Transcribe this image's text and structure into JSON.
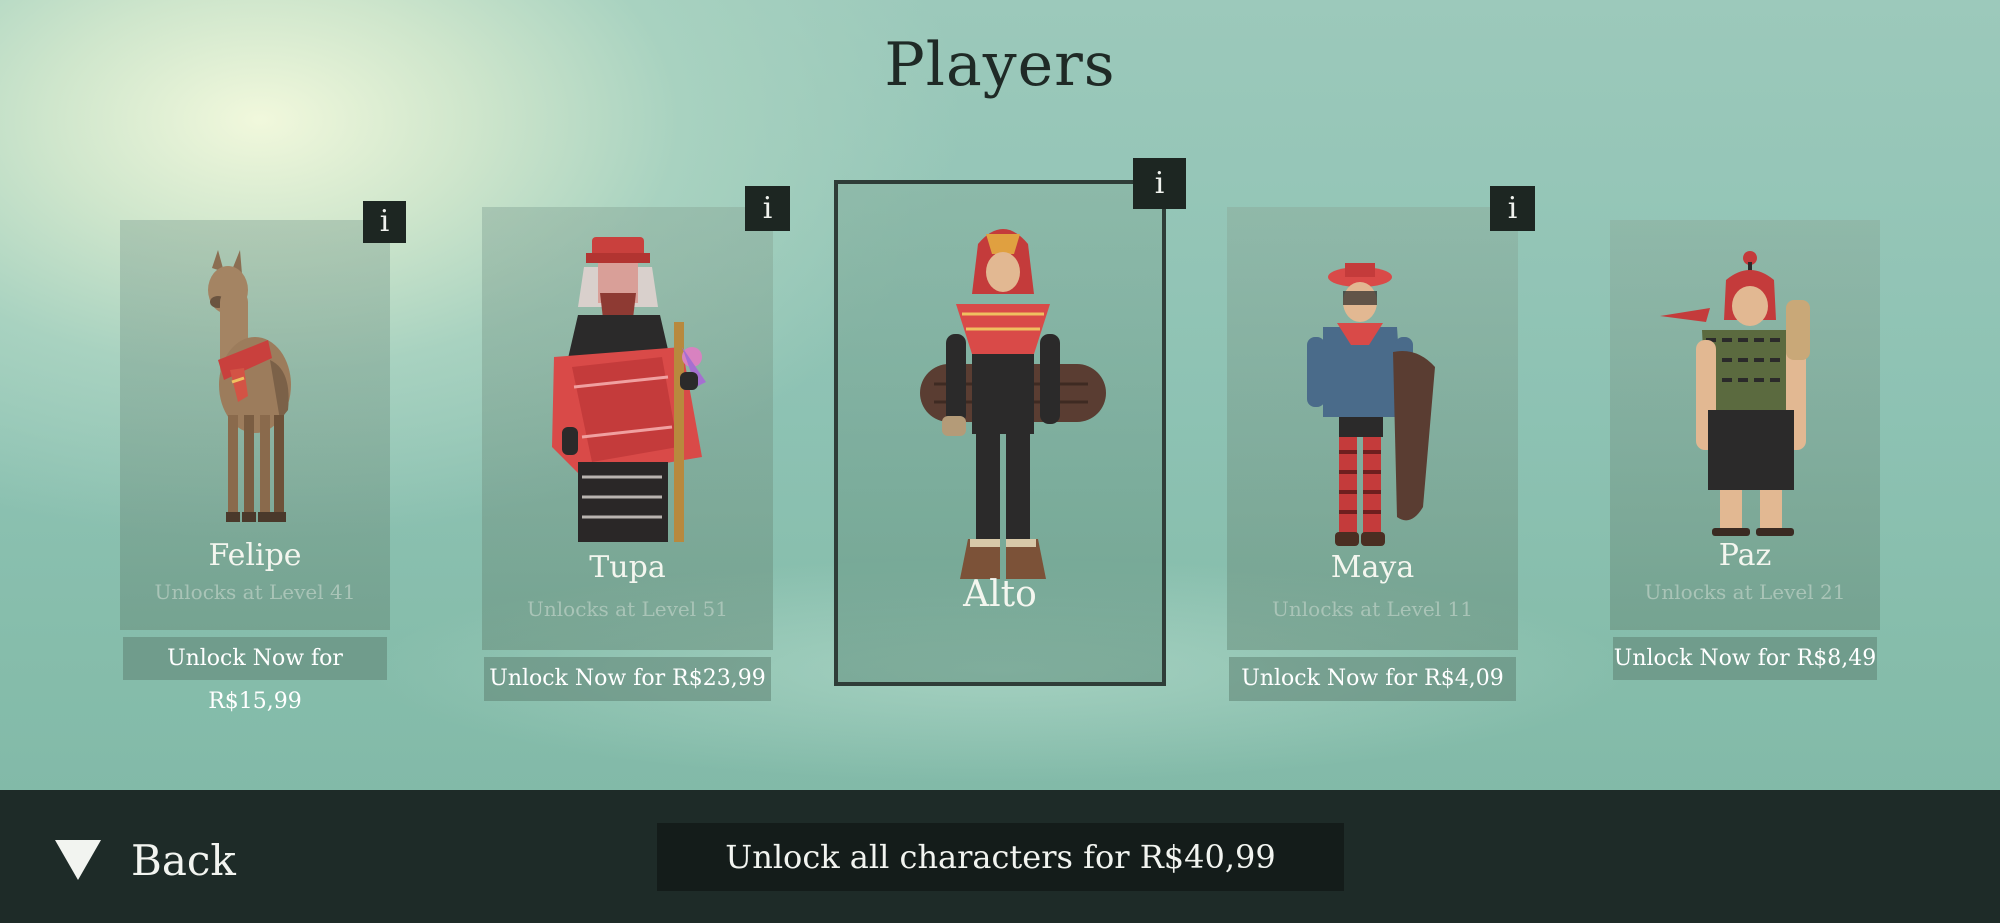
{
  "screen": {
    "title": "Players"
  },
  "characters": [
    {
      "name": "Felipe",
      "unlock_text": "Unlocks at Level 41",
      "buy_label": "Unlock Now for R$15,99",
      "info": "i"
    },
    {
      "name": "Tupa",
      "unlock_text": "Unlocks at Level 51",
      "buy_label": "Unlock Now for R$23,99",
      "info": "i"
    },
    {
      "name": "Alto",
      "info": "i",
      "selected": true
    },
    {
      "name": "Maya",
      "unlock_text": "Unlocks at Level 11",
      "buy_label": "Unlock Now for R$4,09",
      "info": "i"
    },
    {
      "name": "Paz",
      "unlock_text": "Unlocks at Level 21",
      "buy_label": "Unlock Now for R$8,49"
    }
  ],
  "footer": {
    "back_label": "Back",
    "unlock_all_label": "Unlock all characters for R$40,99"
  },
  "icons": {
    "info": "info-icon",
    "back": "triangle-down-icon"
  },
  "colors": {
    "bottom_bar": "#1e2b28",
    "info_badge": "#1d2622",
    "selected_border": "#2f3d38"
  }
}
